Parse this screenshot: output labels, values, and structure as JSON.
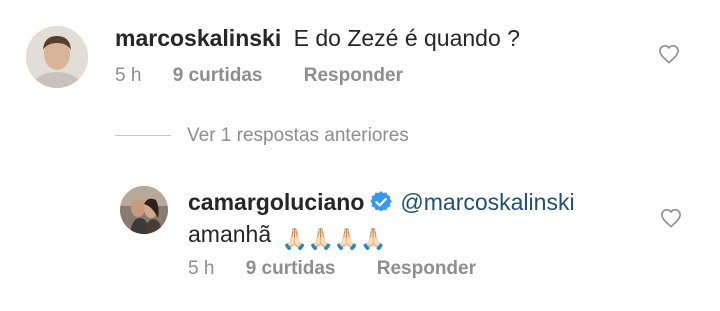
{
  "comment1": {
    "username": "marcoskalinski",
    "text": "E do Zezé é quando ?",
    "time": "5 h",
    "likes": "9 curtidas",
    "reply": "Responder"
  },
  "view_replies": "Ver 1 respostas anteriores",
  "comment2": {
    "username": "camargoluciano",
    "mention": "@marcoskalinski",
    "text": "amanhã",
    "emoji": "🙏🏻🙏🏻🙏🏻🙏🏻",
    "time": "5 h",
    "likes": "9 curtidas",
    "reply": "Responder"
  },
  "colors": {
    "text": "#262626",
    "muted": "#8e8e8e",
    "mention": "#1f4e79",
    "verified": "#3897f0"
  },
  "icons": [
    "heart-icon",
    "verified-badge-icon",
    "avatar"
  ]
}
